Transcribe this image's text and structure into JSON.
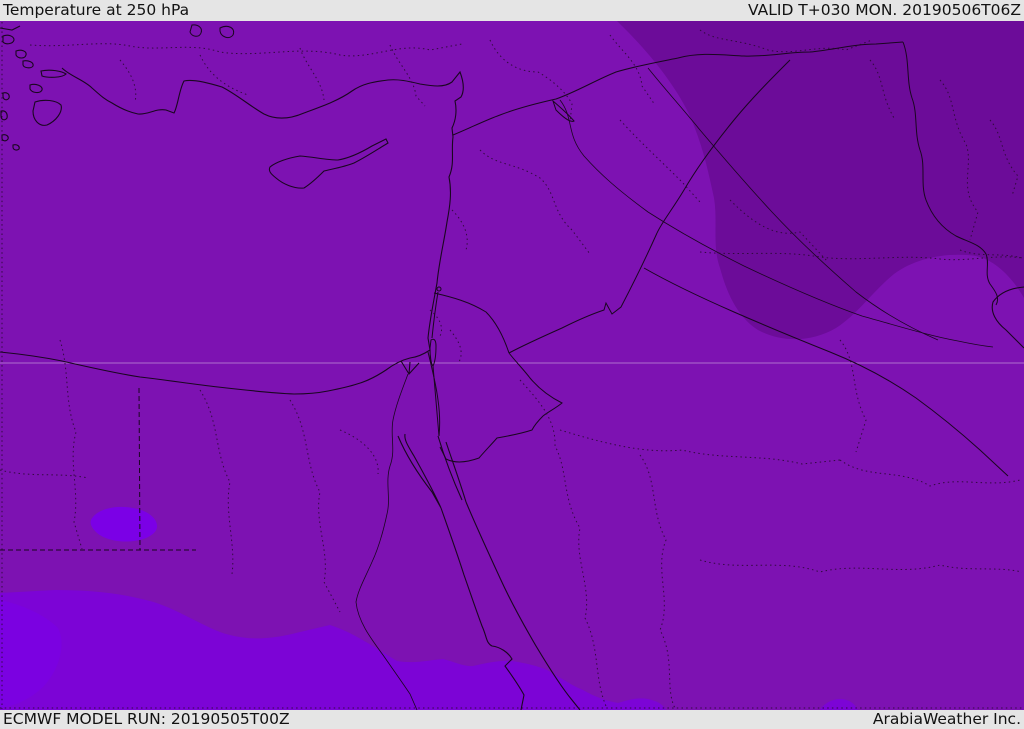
{
  "header": {
    "title": "Temperature at 250 hPa",
    "valid_label": "VALID T+030 MON. 20190506T06Z"
  },
  "footer": {
    "model_run": "ECMWF MODEL RUN: 20190505T00Z",
    "credit": "ArabiaWeather Inc."
  },
  "map": {
    "kind": "upper-air temperature shading map",
    "region": "Eastern Mediterranean / Middle East",
    "colors": {
      "bar_background": "#e5e5e5",
      "bar_text": "#121212",
      "base_purple": "#7d12b2",
      "colder_dark_purple": "#6c0c99",
      "warmer_violet": "#7c04d6",
      "warmest_bright_violet": "#7b00e6",
      "map_lines": "#1a0620",
      "graticule": "#d9b9e4"
    }
  }
}
